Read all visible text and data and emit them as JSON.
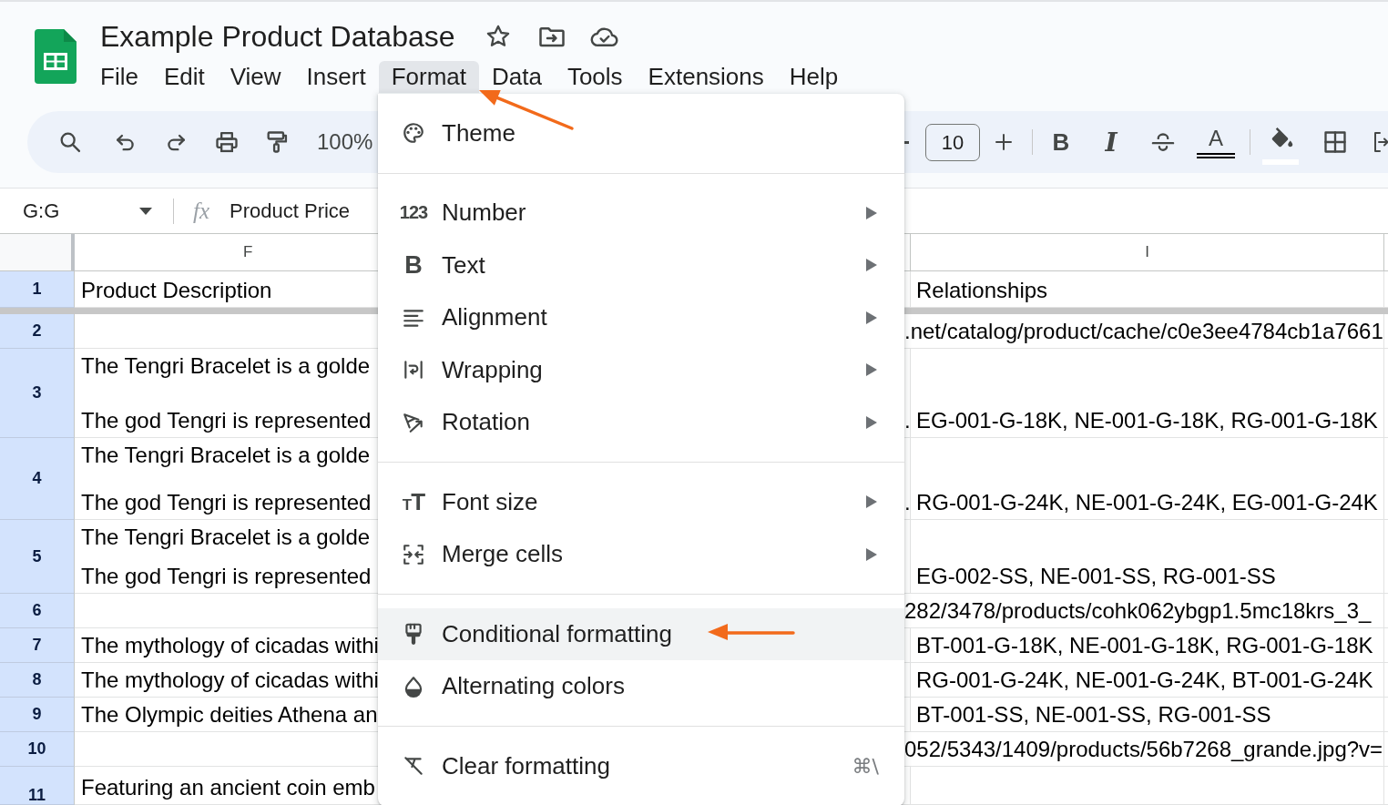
{
  "document": {
    "title": "Example Product Database"
  },
  "menubar": [
    {
      "label": "File",
      "selected": false
    },
    {
      "label": "Edit",
      "selected": false
    },
    {
      "label": "View",
      "selected": false
    },
    {
      "label": "Insert",
      "selected": false
    },
    {
      "label": "Format",
      "selected": true
    },
    {
      "label": "Data",
      "selected": false
    },
    {
      "label": "Tools",
      "selected": false
    },
    {
      "label": "Extensions",
      "selected": false
    },
    {
      "label": "Help",
      "selected": false
    }
  ],
  "toolbar": {
    "zoom": "100%",
    "font_size": "10",
    "bold": "B",
    "italic": "I",
    "text_color": "A"
  },
  "formula_bar": {
    "range": "G:G",
    "fx": "fx",
    "content": "Product Price"
  },
  "grid": {
    "columns": [
      "F",
      "I"
    ],
    "rows": [
      {
        "number": "1",
        "column_f": [
          "Product Description"
        ],
        "column_i": "Relationships"
      },
      {
        "number": "2",
        "overflow_text": ".net/catalog/product/cache/c0e3ee4784cb1a7661"
      },
      {
        "number": "3",
        "column_f": [
          "The Tengri Bracelet is a golde",
          "The god Tengri is represented"
        ],
        "overflow_text": ".",
        "column_i": "EG-001-G-18K, NE-001-G-18K, RG-001-G-18K"
      },
      {
        "number": "4",
        "column_f": [
          "The Tengri Bracelet is a golde",
          "The god Tengri is represented"
        ],
        "overflow_text": ".",
        "column_i": "RG-001-G-24K, NE-001-G-24K, EG-001-G-24K"
      },
      {
        "number": "5",
        "column_f": [
          "The Tengri Bracelet is a golde",
          "The god Tengri is represented"
        ],
        "column_i": "EG-002-SS, NE-001-SS, RG-001-SS"
      },
      {
        "number": "6",
        "overflow_text": "282/3478/products/cohk062ybgp1.5mc18krs_3_"
      },
      {
        "number": "7",
        "column_f": [
          "The mythology of cicadas withi"
        ],
        "column_i": "BT-001-G-18K, NE-001-G-18K, RG-001-G-18K"
      },
      {
        "number": "8",
        "column_f": [
          "The mythology of cicadas withi"
        ],
        "column_i": "RG-001-G-24K, NE-001-G-24K, BT-001-G-24K"
      },
      {
        "number": "9",
        "column_f": [
          "The Olympic deities Athena an"
        ],
        "column_i": "BT-001-SS, NE-001-SS, RG-001-SS"
      },
      {
        "number": "10",
        "overflow_text": "052/5343/1409/products/56b7268_grande.jpg?v="
      },
      {
        "number": "11",
        "column_f": [
          "Featuring an ancient coin emb"
        ]
      }
    ]
  },
  "format_menu": {
    "sections": [
      {
        "items": [
          {
            "kind": "theme",
            "label": "Theme",
            "submenu": false,
            "selected": false
          }
        ]
      },
      {
        "items": [
          {
            "kind": "number",
            "icon_text": "123",
            "label": "Number",
            "submenu": true,
            "selected": false
          },
          {
            "kind": "text",
            "icon_text": "B",
            "label": "Text",
            "submenu": true,
            "selected": false
          },
          {
            "kind": "alignment",
            "label": "Alignment",
            "submenu": true,
            "selected": false
          },
          {
            "kind": "wrapping",
            "label": "Wrapping",
            "submenu": true,
            "selected": false
          },
          {
            "kind": "rotation",
            "label": "Rotation",
            "submenu": true,
            "selected": false
          }
        ]
      },
      {
        "items": [
          {
            "kind": "font_size",
            "icon_text": "TT",
            "label": "Font size",
            "submenu": true,
            "selected": false
          },
          {
            "kind": "merge",
            "label": "Merge cells",
            "submenu": true,
            "selected": false
          }
        ]
      },
      {
        "items": [
          {
            "kind": "conditional",
            "label": "Conditional formatting",
            "submenu": false,
            "selected": true
          },
          {
            "kind": "alternating",
            "label": "Alternating colors",
            "submenu": false,
            "selected": false
          }
        ]
      },
      {
        "items": [
          {
            "kind": "clear",
            "label": "Clear formatting",
            "shortcut": "⌘\\",
            "submenu": false,
            "selected": false
          }
        ]
      }
    ]
  }
}
